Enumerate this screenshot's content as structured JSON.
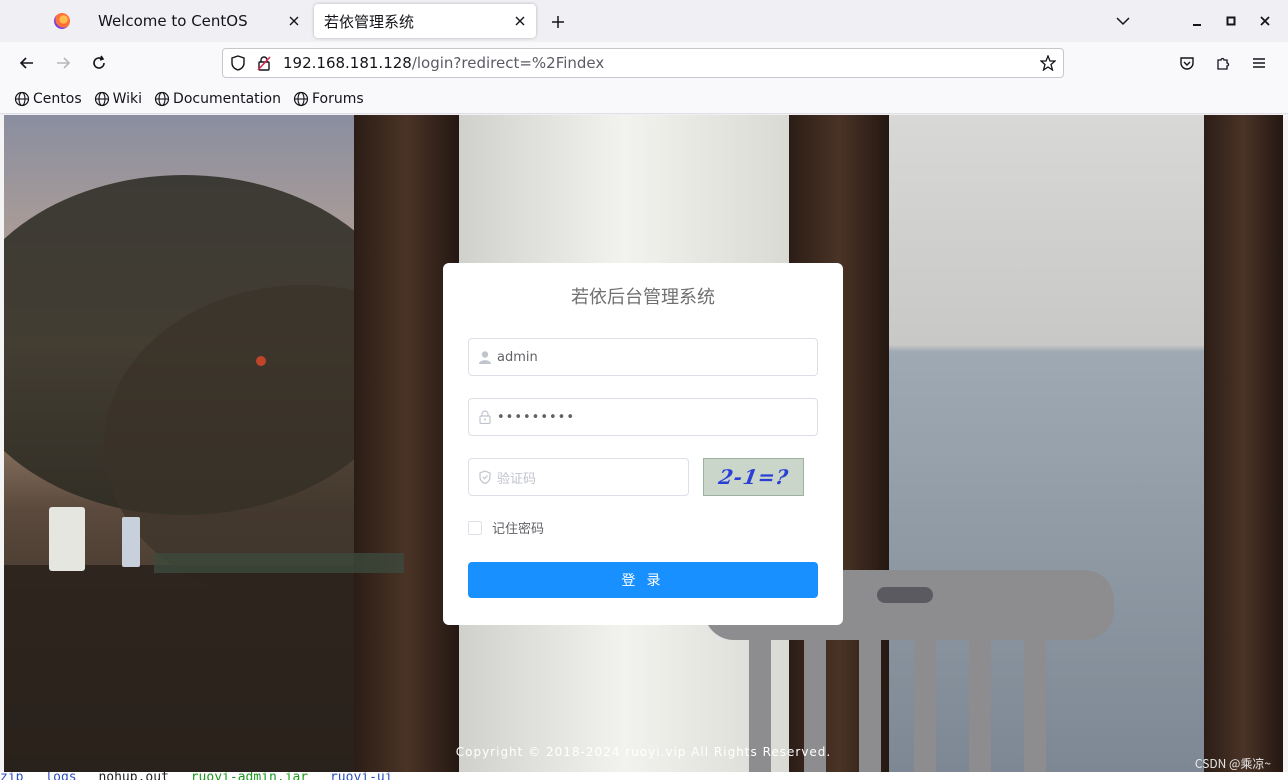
{
  "browser": {
    "tabs": [
      {
        "label": "Welcome to CentOS",
        "active": false
      },
      {
        "label": "若依管理系统",
        "active": true
      }
    ],
    "new_tab_label": "+",
    "url": {
      "host": "192.168.181.128",
      "path": "/login?redirect=%2Findex"
    },
    "bookmarks": [
      {
        "label": "Centos"
      },
      {
        "label": "Wiki"
      },
      {
        "label": "Documentation"
      },
      {
        "label": "Forums"
      }
    ]
  },
  "login": {
    "title": "若依后台管理系统",
    "username_value": "admin",
    "password_value": "•••••••••",
    "captcha_placeholder": "验证码",
    "captcha_text": "2-1=?",
    "remember_label": "记住密码",
    "submit_label": "登 录"
  },
  "footer": {
    "copyright": "Copyright © 2018-2024 ruoyi.vip All Rights Reserved.",
    "watermark": "CSDN @乘凉~"
  },
  "terminal": {
    "items": [
      "zip",
      "logs",
      "nohup.out",
      "ruoyi-admin.jar",
      "ruoyi-ui"
    ]
  },
  "colors": {
    "primary": "#1890ff",
    "card_bg": "#ffffff",
    "captcha_bg": "#c9d6c9",
    "captcha_text": "#2b3fd6"
  }
}
